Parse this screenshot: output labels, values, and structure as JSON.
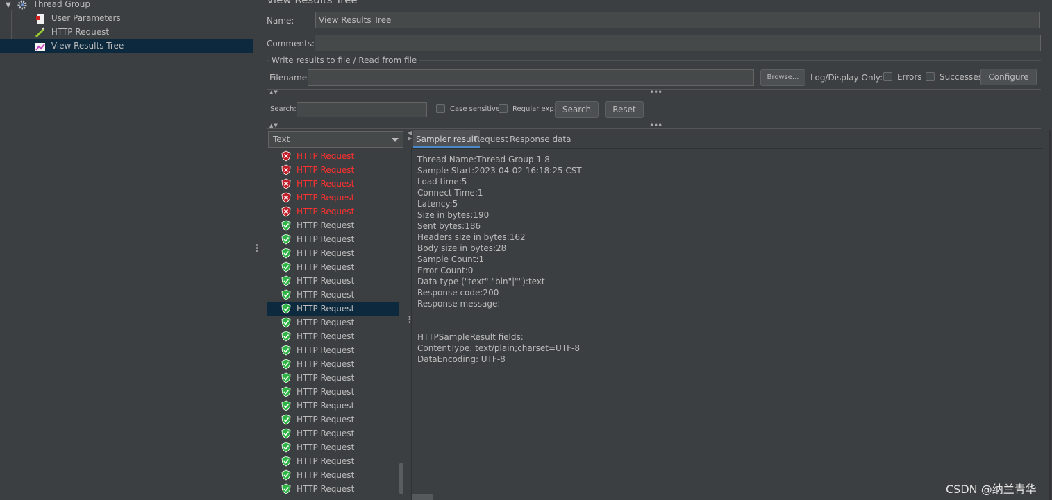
{
  "tree": {
    "items": [
      {
        "label": "Thread Group",
        "icon": "gear-icon"
      },
      {
        "label": "User Parameters",
        "icon": "user-parameters-icon"
      },
      {
        "label": "HTTP Request",
        "icon": "pipette-icon"
      },
      {
        "label": "View Results Tree",
        "icon": "results-tree-icon",
        "selected": true
      }
    ]
  },
  "panel": {
    "title": "View Results Tree",
    "name_label": "Name:",
    "name_value": "View Results Tree",
    "comments_label": "Comments:",
    "comments_value": "",
    "file_group_label": "Write results to file / Read from file",
    "filename_label": "Filename",
    "filename_value": "",
    "browse_label": "Browse...",
    "log_display_label": "Log/Display Only:",
    "errors_label": "Errors",
    "successes_label": "Successes",
    "configure_label": "Configure"
  },
  "search": {
    "label": "Search:",
    "value": "",
    "case_sensitive_label": "Case sensitive",
    "regex_label": "Regular exp.",
    "search_button": "Search",
    "reset_button": "Reset"
  },
  "renderer": {
    "selected": "Text"
  },
  "results": {
    "selected_index": 11,
    "items": [
      {
        "label": "HTTP Request",
        "status": "error"
      },
      {
        "label": "HTTP Request",
        "status": "error"
      },
      {
        "label": "HTTP Request",
        "status": "error"
      },
      {
        "label": "HTTP Request",
        "status": "error"
      },
      {
        "label": "HTTP Request",
        "status": "error"
      },
      {
        "label": "HTTP Request",
        "status": "ok"
      },
      {
        "label": "HTTP Request",
        "status": "ok"
      },
      {
        "label": "HTTP Request",
        "status": "ok"
      },
      {
        "label": "HTTP Request",
        "status": "ok"
      },
      {
        "label": "HTTP Request",
        "status": "ok"
      },
      {
        "label": "HTTP Request",
        "status": "ok"
      },
      {
        "label": "HTTP Request",
        "status": "ok"
      },
      {
        "label": "HTTP Request",
        "status": "ok"
      },
      {
        "label": "HTTP Request",
        "status": "ok"
      },
      {
        "label": "HTTP Request",
        "status": "ok"
      },
      {
        "label": "HTTP Request",
        "status": "ok"
      },
      {
        "label": "HTTP Request",
        "status": "ok"
      },
      {
        "label": "HTTP Request",
        "status": "ok"
      },
      {
        "label": "HTTP Request",
        "status": "ok"
      },
      {
        "label": "HTTP Request",
        "status": "ok"
      },
      {
        "label": "HTTP Request",
        "status": "ok"
      },
      {
        "label": "HTTP Request",
        "status": "ok"
      },
      {
        "label": "HTTP Request",
        "status": "ok"
      },
      {
        "label": "HTTP Request",
        "status": "ok"
      },
      {
        "label": "HTTP Request",
        "status": "ok"
      }
    ]
  },
  "tabs": [
    {
      "label": "Sampler result",
      "active": true
    },
    {
      "label": "Request",
      "active": false
    },
    {
      "label": "Response data",
      "active": false
    }
  ],
  "sampler_result": {
    "lines": [
      "Thread Name:Thread Group 1-8",
      "Sample Start:2023-04-02 16:18:25 CST",
      "Load time:5",
      "Connect Time:1",
      "Latency:5",
      "Size in bytes:190",
      "Sent bytes:186",
      "Headers size in bytes:162",
      "Body size in bytes:28",
      "Sample Count:1",
      "Error Count:0",
      "Data type (\"text\"|\"bin\"|\"\"):text",
      "Response code:200",
      "Response message:",
      "",
      "",
      "HTTPSampleResult fields:",
      "ContentType: text/plain;charset=UTF-8",
      "DataEncoding: UTF-8"
    ]
  },
  "watermark": "CSDN @纳兰青华",
  "colors": {
    "background": "#3c3f41",
    "selection": "#0d293e",
    "error_text": "#ff3030",
    "ok_icon": "#2fb344",
    "error_icon": "#c0202a"
  }
}
